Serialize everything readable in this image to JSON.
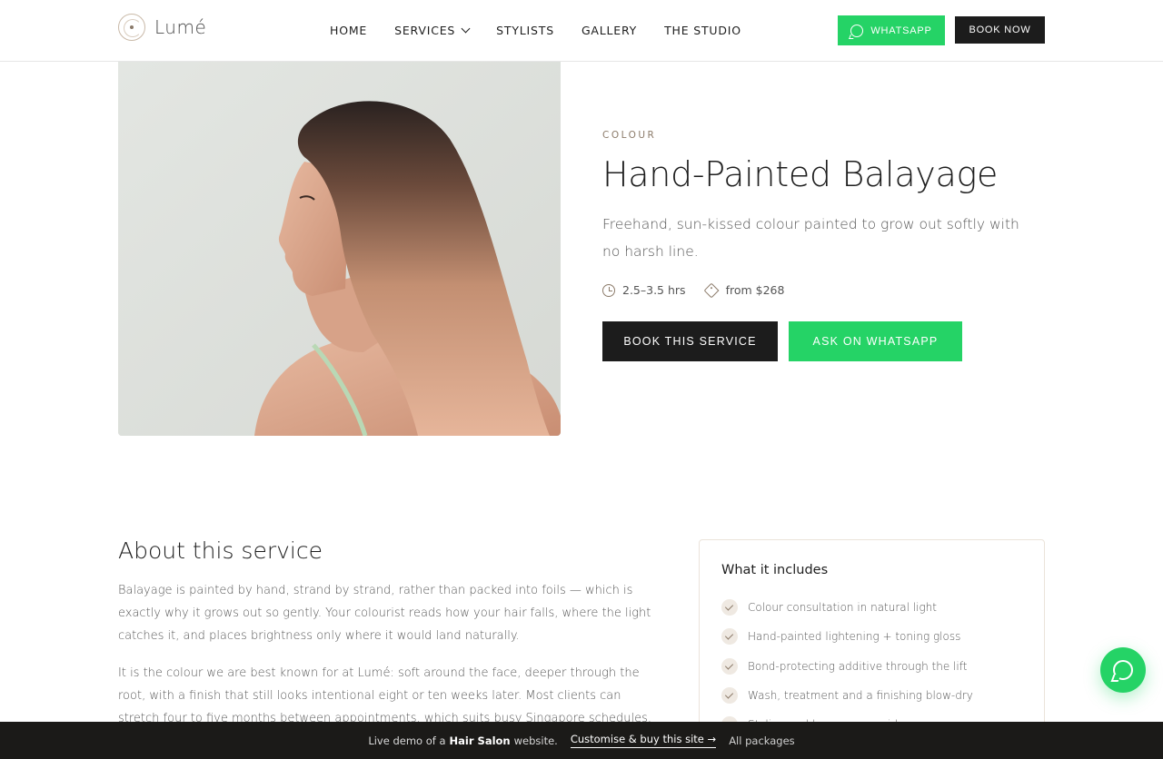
{
  "header": {
    "logo_text": "Lumé",
    "nav": [
      {
        "label": "HOME"
      },
      {
        "label": "SERVICES"
      },
      {
        "label": "STYLISTS"
      },
      {
        "label": "GALLERY"
      },
      {
        "label": "THE STUDIO"
      }
    ],
    "whatsapp_label": "WHATSAPP",
    "book_now_label": "BOOK NOW"
  },
  "hero": {
    "eyebrow": "COLOUR",
    "title": "Hand-Painted Balayage",
    "subtitle": "Freehand, sun-kissed colour painted to grow out softly with no harsh line.",
    "duration": "2.5–3.5 hrs",
    "price": "from $268",
    "book_label": "BOOK THIS SERVICE",
    "ask_label": "ASK ON WHATSAPP"
  },
  "about": {
    "title": "About this service",
    "p1": "Balayage is painted by hand, strand by strand, rather than packed into foils — which is exactly why it grows out so gently. Your colourist reads how your hair falls, where the light catches it, and places brightness only where it would land naturally.",
    "p2": "It is the colour we are best known for at Lumé: soft around the face, deeper through the root, with a finish that still looks intentional eight or ten weeks later. Most clients can stretch four to five months between appointments, which suits busy Singapore schedules."
  },
  "includes": {
    "title": "What it includes",
    "items": [
      "Colour consultation in natural light",
      "Hand-painted lightening + toning gloss",
      "Bond-protecting additive through the lift",
      "Wash, treatment and a finishing blow-dry",
      "Styling and home-care guidance"
    ]
  },
  "bottom_bar": {
    "demo_prefix": "Live demo of a",
    "demo_strong": "Hair Salon",
    "demo_suffix": "website.",
    "cta": "Customise & buy this site →",
    "packages": "All packages"
  },
  "colors": {
    "accent_green": "#25d366",
    "dark": "#1c1c1c",
    "eyebrow_brown": "#8c7b6a"
  }
}
